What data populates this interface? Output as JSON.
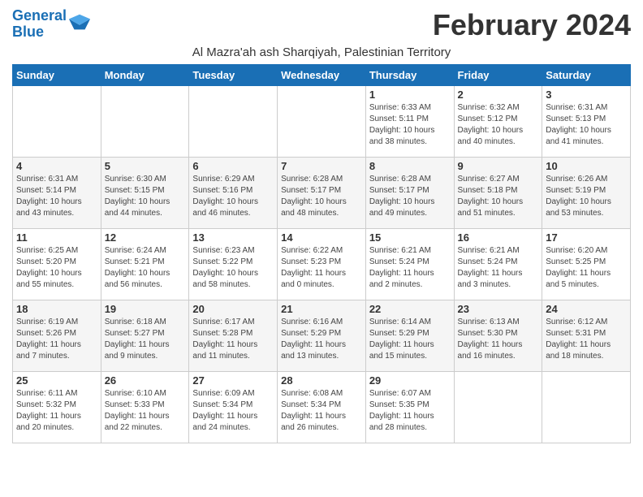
{
  "logo": {
    "line1": "General",
    "line2": "Blue"
  },
  "title": "February 2024",
  "location": "Al Mazra'ah ash Sharqiyah, Palestinian Territory",
  "weekdays": [
    "Sunday",
    "Monday",
    "Tuesday",
    "Wednesday",
    "Thursday",
    "Friday",
    "Saturday"
  ],
  "weeks": [
    [
      {
        "day": "",
        "info": ""
      },
      {
        "day": "",
        "info": ""
      },
      {
        "day": "",
        "info": ""
      },
      {
        "day": "",
        "info": ""
      },
      {
        "day": "1",
        "info": "Sunrise: 6:33 AM\nSunset: 5:11 PM\nDaylight: 10 hours\nand 38 minutes."
      },
      {
        "day": "2",
        "info": "Sunrise: 6:32 AM\nSunset: 5:12 PM\nDaylight: 10 hours\nand 40 minutes."
      },
      {
        "day": "3",
        "info": "Sunrise: 6:31 AM\nSunset: 5:13 PM\nDaylight: 10 hours\nand 41 minutes."
      }
    ],
    [
      {
        "day": "4",
        "info": "Sunrise: 6:31 AM\nSunset: 5:14 PM\nDaylight: 10 hours\nand 43 minutes."
      },
      {
        "day": "5",
        "info": "Sunrise: 6:30 AM\nSunset: 5:15 PM\nDaylight: 10 hours\nand 44 minutes."
      },
      {
        "day": "6",
        "info": "Sunrise: 6:29 AM\nSunset: 5:16 PM\nDaylight: 10 hours\nand 46 minutes."
      },
      {
        "day": "7",
        "info": "Sunrise: 6:28 AM\nSunset: 5:17 PM\nDaylight: 10 hours\nand 48 minutes."
      },
      {
        "day": "8",
        "info": "Sunrise: 6:28 AM\nSunset: 5:17 PM\nDaylight: 10 hours\nand 49 minutes."
      },
      {
        "day": "9",
        "info": "Sunrise: 6:27 AM\nSunset: 5:18 PM\nDaylight: 10 hours\nand 51 minutes."
      },
      {
        "day": "10",
        "info": "Sunrise: 6:26 AM\nSunset: 5:19 PM\nDaylight: 10 hours\nand 53 minutes."
      }
    ],
    [
      {
        "day": "11",
        "info": "Sunrise: 6:25 AM\nSunset: 5:20 PM\nDaylight: 10 hours\nand 55 minutes."
      },
      {
        "day": "12",
        "info": "Sunrise: 6:24 AM\nSunset: 5:21 PM\nDaylight: 10 hours\nand 56 minutes."
      },
      {
        "day": "13",
        "info": "Sunrise: 6:23 AM\nSunset: 5:22 PM\nDaylight: 10 hours\nand 58 minutes."
      },
      {
        "day": "14",
        "info": "Sunrise: 6:22 AM\nSunset: 5:23 PM\nDaylight: 11 hours\nand 0 minutes."
      },
      {
        "day": "15",
        "info": "Sunrise: 6:21 AM\nSunset: 5:24 PM\nDaylight: 11 hours\nand 2 minutes."
      },
      {
        "day": "16",
        "info": "Sunrise: 6:21 AM\nSunset: 5:24 PM\nDaylight: 11 hours\nand 3 minutes."
      },
      {
        "day": "17",
        "info": "Sunrise: 6:20 AM\nSunset: 5:25 PM\nDaylight: 11 hours\nand 5 minutes."
      }
    ],
    [
      {
        "day": "18",
        "info": "Sunrise: 6:19 AM\nSunset: 5:26 PM\nDaylight: 11 hours\nand 7 minutes."
      },
      {
        "day": "19",
        "info": "Sunrise: 6:18 AM\nSunset: 5:27 PM\nDaylight: 11 hours\nand 9 minutes."
      },
      {
        "day": "20",
        "info": "Sunrise: 6:17 AM\nSunset: 5:28 PM\nDaylight: 11 hours\nand 11 minutes."
      },
      {
        "day": "21",
        "info": "Sunrise: 6:16 AM\nSunset: 5:29 PM\nDaylight: 11 hours\nand 13 minutes."
      },
      {
        "day": "22",
        "info": "Sunrise: 6:14 AM\nSunset: 5:29 PM\nDaylight: 11 hours\nand 15 minutes."
      },
      {
        "day": "23",
        "info": "Sunrise: 6:13 AM\nSunset: 5:30 PM\nDaylight: 11 hours\nand 16 minutes."
      },
      {
        "day": "24",
        "info": "Sunrise: 6:12 AM\nSunset: 5:31 PM\nDaylight: 11 hours\nand 18 minutes."
      }
    ],
    [
      {
        "day": "25",
        "info": "Sunrise: 6:11 AM\nSunset: 5:32 PM\nDaylight: 11 hours\nand 20 minutes."
      },
      {
        "day": "26",
        "info": "Sunrise: 6:10 AM\nSunset: 5:33 PM\nDaylight: 11 hours\nand 22 minutes."
      },
      {
        "day": "27",
        "info": "Sunrise: 6:09 AM\nSunset: 5:34 PM\nDaylight: 11 hours\nand 24 minutes."
      },
      {
        "day": "28",
        "info": "Sunrise: 6:08 AM\nSunset: 5:34 PM\nDaylight: 11 hours\nand 26 minutes."
      },
      {
        "day": "29",
        "info": "Sunrise: 6:07 AM\nSunset: 5:35 PM\nDaylight: 11 hours\nand 28 minutes."
      },
      {
        "day": "",
        "info": ""
      },
      {
        "day": "",
        "info": ""
      }
    ]
  ]
}
